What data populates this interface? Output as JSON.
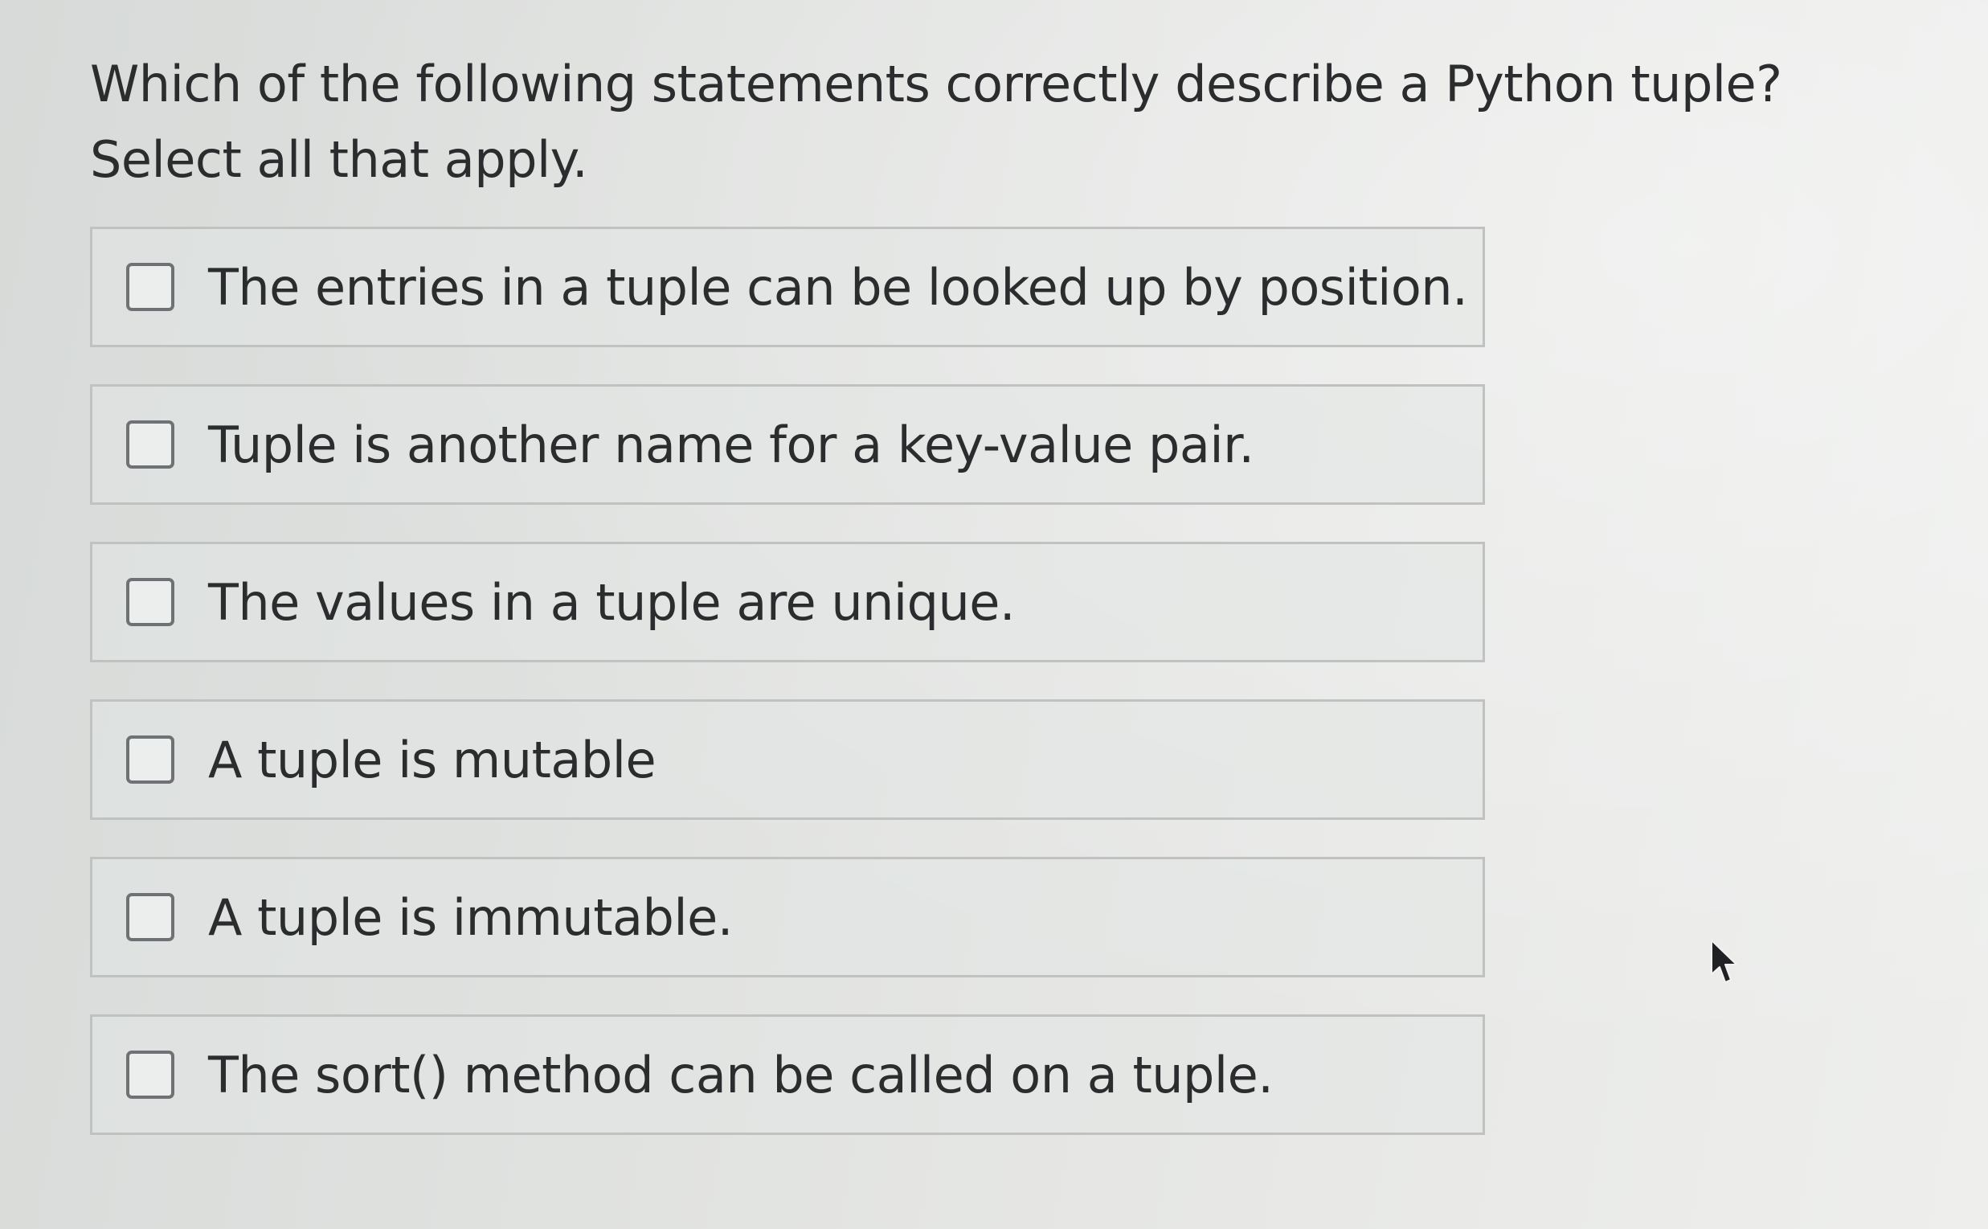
{
  "question": {
    "text": "Which of the following statements correctly describe a Python tuple? Select all that apply."
  },
  "options": [
    {
      "label": "The entries in a tuple can be looked up by position.",
      "checked": false
    },
    {
      "label": "Tuple is another name for a key-value pair.",
      "checked": false
    },
    {
      "label": "The values in a tuple are unique.",
      "checked": false
    },
    {
      "label": "A tuple is mutable",
      "checked": false
    },
    {
      "label": "A tuple is immutable.",
      "checked": false
    },
    {
      "label": "The sort() method can be called on a tuple.",
      "checked": false
    }
  ],
  "icons": {
    "checkbox": "empty-checkbox-icon",
    "cursor": "mouse-pointer-icon"
  },
  "colors": {
    "background": "#e0e2e0",
    "text": "#2a2c2e",
    "option_border": "#bfc2c1",
    "checkbox_border": "#6f7274"
  }
}
